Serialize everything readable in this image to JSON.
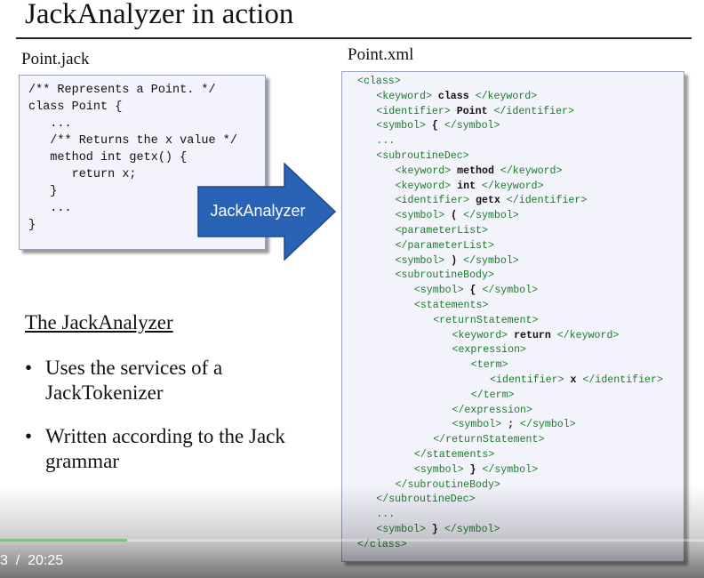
{
  "slide": {
    "title": "JackAnalyzer in action",
    "left_file_label": "Point.jack",
    "right_file_label": "Point.xml",
    "jack_code": "/** Represents a Point. */\nclass Point {\n   ...\n   /** Returns the x value */\n   method int getx() {\n      return x;\n   }\n   ...\n}",
    "arrow_label": "JackAnalyzer",
    "analyzer_heading": "The JackAnalyzer",
    "bullets": [
      "Uses the services of a JackTokenizer",
      "Written according to the Jack grammar"
    ],
    "bullet_char": "•"
  },
  "xml_lines": [
    {
      "indent": 0,
      "open": "<class>",
      "value": "",
      "close": ""
    },
    {
      "indent": 1,
      "open": "<keyword>",
      "value": "class",
      "close": "</keyword>"
    },
    {
      "indent": 1,
      "open": "<identifier>",
      "value": "Point",
      "close": "</identifier>"
    },
    {
      "indent": 1,
      "open": "<symbol>",
      "value": "{",
      "close": "</symbol>"
    },
    {
      "indent": 1,
      "open": "...",
      "value": "",
      "close": ""
    },
    {
      "indent": 1,
      "open": "<subroutineDec>",
      "value": "",
      "close": ""
    },
    {
      "indent": 2,
      "open": "<keyword>",
      "value": "method",
      "close": "</keyword>"
    },
    {
      "indent": 2,
      "open": "<keyword>",
      "value": "int",
      "close": "</keyword>"
    },
    {
      "indent": 2,
      "open": "<identifier>",
      "value": "getx",
      "close": "</identifier>"
    },
    {
      "indent": 2,
      "open": "<symbol>",
      "value": "(",
      "close": "</symbol>"
    },
    {
      "indent": 2,
      "open": "<parameterList>",
      "value": "",
      "close": ""
    },
    {
      "indent": 2,
      "open": "</parameterList>",
      "value": "",
      "close": ""
    },
    {
      "indent": 2,
      "open": "<symbol>",
      "value": ")",
      "close": "</symbol>"
    },
    {
      "indent": 2,
      "open": "<subroutineBody>",
      "value": "",
      "close": ""
    },
    {
      "indent": 3,
      "open": "<symbol>",
      "value": "{",
      "close": "</symbol>"
    },
    {
      "indent": 3,
      "open": "<statements>",
      "value": "",
      "close": ""
    },
    {
      "indent": 4,
      "open": "<returnStatement>",
      "value": "",
      "close": ""
    },
    {
      "indent": 5,
      "open": "<keyword>",
      "value": "return",
      "close": "</keyword>"
    },
    {
      "indent": 5,
      "open": "<expression>",
      "value": "",
      "close": ""
    },
    {
      "indent": 6,
      "open": "<term>",
      "value": "",
      "close": ""
    },
    {
      "indent": 7,
      "open": "<identifier>",
      "value": "x",
      "close": "</identifier>"
    },
    {
      "indent": 6,
      "open": "</term>",
      "value": "",
      "close": ""
    },
    {
      "indent": 5,
      "open": "</expression>",
      "value": "",
      "close": ""
    },
    {
      "indent": 5,
      "open": "<symbol>",
      "value": ";",
      "close": "</symbol>"
    },
    {
      "indent": 4,
      "open": "</returnStatement>",
      "value": "",
      "close": ""
    },
    {
      "indent": 3,
      "open": "</statements>",
      "value": "",
      "close": ""
    },
    {
      "indent": 3,
      "open": "<symbol>",
      "value": "}",
      "close": "</symbol>"
    },
    {
      "indent": 2,
      "open": "</subroutineBody>",
      "value": "",
      "close": ""
    },
    {
      "indent": 1,
      "open": "</subroutineDec>",
      "value": "",
      "close": ""
    },
    {
      "indent": 1,
      "open": "...",
      "value": "",
      "close": ""
    },
    {
      "indent": 1,
      "open": "<symbol>",
      "value": "}",
      "close": "</symbol>"
    },
    {
      "indent": 0,
      "open": "</class>",
      "value": "",
      "close": ""
    }
  ],
  "player": {
    "time_text": "3  /  20:25",
    "progress_fraction": 0.18,
    "progress_color": "#7fc08f"
  },
  "colors": {
    "xml_tag": "#1e7b2c",
    "arrow_fill": "#2a62b6",
    "code_box_bg": "#f2f3fb"
  }
}
